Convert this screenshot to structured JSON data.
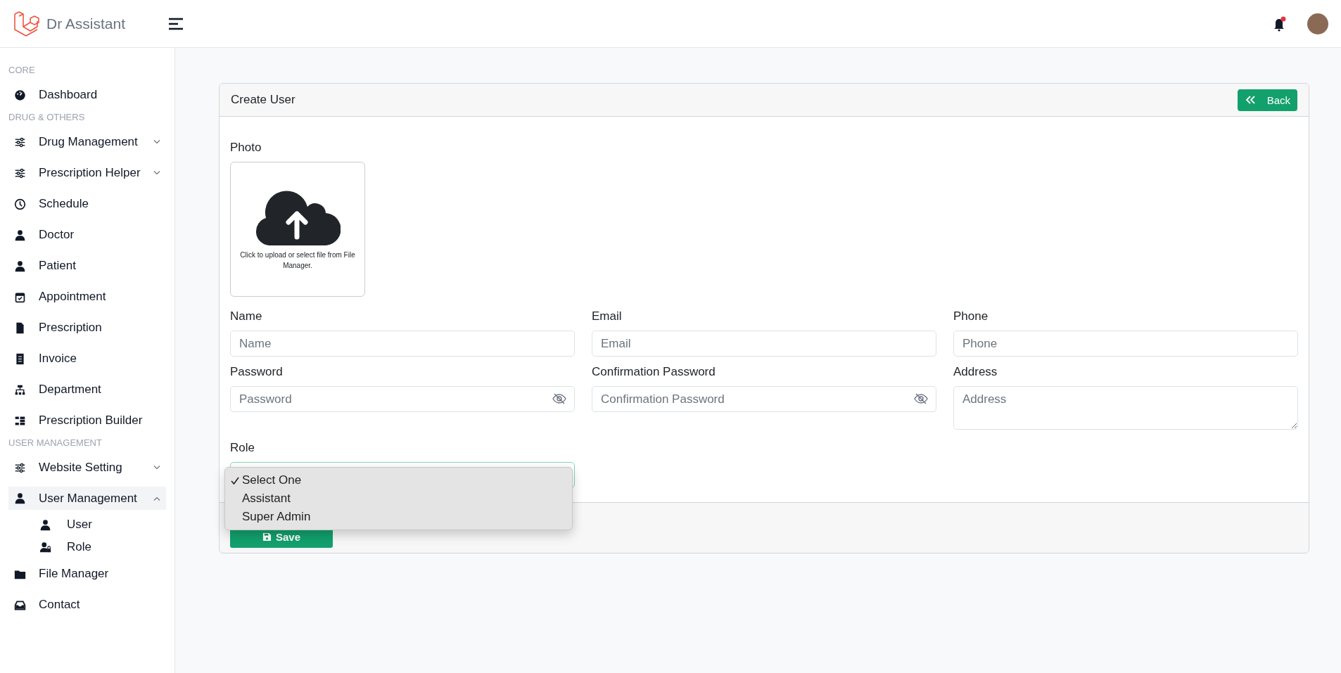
{
  "header": {
    "brand": "Dr Assistant",
    "notification_dot": true
  },
  "sidebar": {
    "sections": [
      {
        "heading": "CORE",
        "items": [
          {
            "label": "Dashboard",
            "selected": false
          }
        ]
      },
      {
        "heading": "DRUG & OTHERS",
        "items": [
          {
            "label": "Drug Management",
            "selected": false,
            "expanded": false
          },
          {
            "label": "Prescription Helper",
            "selected": false,
            "expanded": false
          },
          {
            "label": "Schedule",
            "selected": false
          },
          {
            "label": "Doctor",
            "selected": false
          },
          {
            "label": "Patient",
            "selected": false
          },
          {
            "label": "Appointment",
            "selected": false
          },
          {
            "label": "Prescription",
            "selected": false
          },
          {
            "label": "Invoice",
            "selected": false
          },
          {
            "label": "Department",
            "selected": false
          },
          {
            "label": "Prescription Builder",
            "selected": false
          }
        ]
      },
      {
        "heading": "USER MANAGEMENT",
        "items": [
          {
            "label": "Website Setting",
            "selected": false,
            "expanded": false
          },
          {
            "label": "User Management",
            "selected": true,
            "expanded": true,
            "children": [
              {
                "label": "User",
                "selected": false
              },
              {
                "label": "Role",
                "selected": false
              }
            ]
          },
          {
            "label": "File Manager",
            "selected": false
          },
          {
            "label": "Contact",
            "selected": false
          }
        ]
      }
    ]
  },
  "card": {
    "title": "Create User",
    "back_button": "Back",
    "photo": {
      "label": "Photo",
      "hint": "Click to upload or select file from File Manager."
    },
    "fields": [
      {
        "kind": "input",
        "label": "Name",
        "placeholder": "Name"
      },
      {
        "kind": "input",
        "label": "Email",
        "placeholder": "Email"
      },
      {
        "kind": "input",
        "label": "Phone",
        "placeholder": "Phone"
      },
      {
        "kind": "password",
        "label": "Password",
        "placeholder": "Password"
      },
      {
        "kind": "password",
        "label": "Confirmation Password",
        "placeholder": "Confirmation Password"
      },
      {
        "kind": "textarea",
        "label": "Address",
        "placeholder": "Address"
      }
    ],
    "role": {
      "label": "Role",
      "open": true,
      "options": [
        {
          "label": "Select One",
          "selected": true
        },
        {
          "label": "Assistant",
          "selected": false
        },
        {
          "label": "Super Admin",
          "selected": false
        }
      ]
    },
    "save_button": "Save"
  }
}
